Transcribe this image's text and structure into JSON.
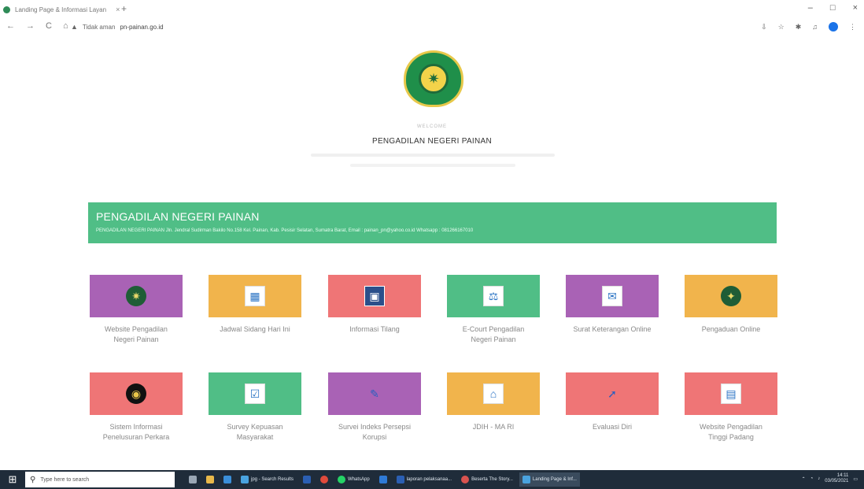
{
  "browser": {
    "tab_title": "Landing Page & Informasi Layan",
    "tab_close": "×",
    "new_tab": "+",
    "nav": {
      "back": "←",
      "forward": "→",
      "reload": "C",
      "home": "⌂"
    },
    "security_label": "Tidak aman",
    "url": "pn-painan.go.id",
    "window_controls": {
      "minimize": "–",
      "maximize": "□",
      "close": "×"
    }
  },
  "header": {
    "welcome": "WELCOME",
    "title": "PENGADILAN NEGERI PAINAN"
  },
  "banner": {
    "title": "PENGADILAN NEGERI PAINAN",
    "subtitle": "PENGADILAN NEGERI PAINAN Jln. Jendral Sudirman Bakilo No.158 Kel. Painan, Kab. Pesisir Selatan, Sumatra Barat, Email : painan_pn@yahoo.co.id Whatsapp : 081266167010",
    "color": "#50be86"
  },
  "tiles": [
    {
      "label_lines": [
        "Website Pengadilan",
        "Negeri Painan"
      ],
      "color": "purple",
      "icon": "court-logo-icon"
    },
    {
      "label_lines": [
        "Jadwal Sidang Hari Ini"
      ],
      "color": "orange",
      "icon": "calendar-icon"
    },
    {
      "label_lines": [
        "Informasi Tilang"
      ],
      "color": "red",
      "icon": "traffic-ticket-icon"
    },
    {
      "label_lines": [
        "E-Court Pengadilan",
        "Negeri Painan"
      ],
      "color": "green",
      "icon": "ecourt-icon"
    },
    {
      "label_lines": [
        "Surat Keterangan Online"
      ],
      "color": "purple",
      "icon": "certificate-icon"
    },
    {
      "label_lines": [
        "Pengaduan Online"
      ],
      "color": "orange",
      "icon": "complaint-icon"
    },
    {
      "label_lines": [
        "Sistem Informasi",
        "Penelusuran Perkara"
      ],
      "color": "red",
      "icon": "case-search-icon"
    },
    {
      "label_lines": [
        "Survey Kepuasan",
        "Masyarakat"
      ],
      "color": "green",
      "icon": "survey-icon"
    },
    {
      "label_lines": [
        "Survei Indeks Persepsi",
        "Korupsi"
      ],
      "color": "purple",
      "icon": "corruption-survey-icon"
    },
    {
      "label_lines": [
        "JDIH - MA RI"
      ],
      "color": "orange",
      "icon": "jdih-icon"
    },
    {
      "label_lines": [
        "Evaluasi Diri"
      ],
      "color": "red",
      "icon": "self-evaluation-icon"
    },
    {
      "label_lines": [
        "Website Pengadilan",
        "Tinggi Padang"
      ],
      "color": "red",
      "icon": "high-court-icon"
    }
  ],
  "taskbar": {
    "search_placeholder": "Type here to search",
    "items": [
      {
        "label": "",
        "icon": "task-view-icon"
      },
      {
        "label": "",
        "icon": "file-explorer-icon"
      },
      {
        "label": "",
        "icon": "browser-icon"
      },
      {
        "label": "jpg - Search Results",
        "icon": "chrome-icon"
      },
      {
        "label": "",
        "icon": "word-icon"
      },
      {
        "label": "",
        "icon": "chrome-profile-icon"
      },
      {
        "label": "WhatsApp",
        "icon": "whatsapp-icon"
      },
      {
        "label": "",
        "icon": "mail-icon"
      },
      {
        "label": "laporan pelaksanaa...",
        "icon": "word-doc-icon"
      },
      {
        "label": "Beserta The Story...",
        "icon": "browser2-icon"
      },
      {
        "label": "Landing Page & Inf...",
        "icon": "chrome-active-icon"
      }
    ],
    "time": "14:11",
    "date": "03/05/2021"
  }
}
